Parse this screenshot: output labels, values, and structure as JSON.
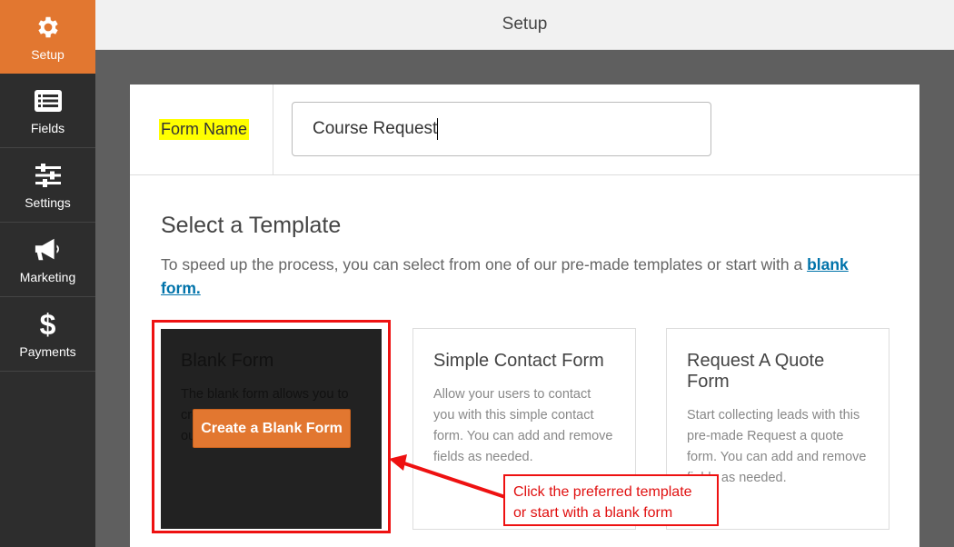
{
  "sidebar": {
    "items": [
      {
        "label": "Setup",
        "icon": "gear-icon",
        "active": true
      },
      {
        "label": "Fields",
        "icon": "fields-icon"
      },
      {
        "label": "Settings",
        "icon": "sliders-icon"
      },
      {
        "label": "Marketing",
        "icon": "megaphone-icon"
      },
      {
        "label": "Payments",
        "icon": "dollar-icon"
      }
    ]
  },
  "topbar": {
    "title": "Setup"
  },
  "form_name": {
    "label": "Form Name",
    "value": "Course Request"
  },
  "template": {
    "heading": "Select a Template",
    "description_prefix": "To speed up the process, you can select from one of our pre-made templates or start with a ",
    "description_link": "blank form.",
    "cards": [
      {
        "title": "Blank Form",
        "description": "The blank form allows you to create any type of form using our drag & drop builder.",
        "button": "Create a Blank Form"
      },
      {
        "title": "Simple Contact Form",
        "description": "Allow your users to contact you with this simple contact form. You can add and remove fields as needed."
      },
      {
        "title": "Request A Quote Form",
        "description": "Start collecting leads with this pre-made Request a quote form. You can add and remove fields as needed."
      }
    ]
  },
  "annotation": {
    "callout": "Click the preferred template or start with a blank form"
  },
  "colors": {
    "accent": "#e27730",
    "sidebar": "#2d2d2d",
    "highlight": "#ffff00",
    "annotation_red": "#ee1111"
  }
}
